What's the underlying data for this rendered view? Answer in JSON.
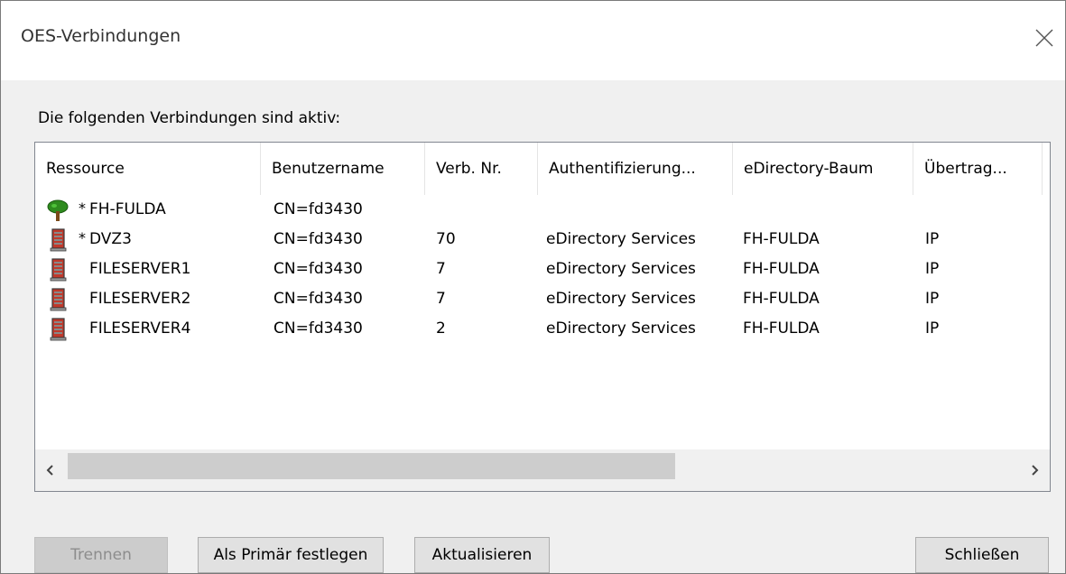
{
  "window": {
    "title": "OES-Verbindungen",
    "close_icon": "close-icon"
  },
  "intro_text": "Die folgenden Verbindungen sind aktiv:",
  "columns": [
    "Ressource",
    "Benutzername",
    "Verb. Nr.",
    "Authentifizierung...",
    "eDirectory-Baum",
    "Übertrag..."
  ],
  "rows": [
    {
      "icon": "tree-icon",
      "primary": "*",
      "resource": "FH-FULDA",
      "user": "CN=fd3430",
      "conn_nr": "",
      "auth": "",
      "tree": "",
      "transport": ""
    },
    {
      "icon": "server-icon",
      "primary": "*",
      "resource": "DVZ3",
      "user": "CN=fd3430",
      "conn_nr": "70",
      "auth": "eDirectory Services",
      "tree": "FH-FULDA",
      "transport": "IP"
    },
    {
      "icon": "server-icon",
      "primary": "",
      "resource": "FILESERVER1",
      "user": "CN=fd3430",
      "conn_nr": "7",
      "auth": "eDirectory Services",
      "tree": "FH-FULDA",
      "transport": "IP"
    },
    {
      "icon": "server-icon",
      "primary": "",
      "resource": "FILESERVER2",
      "user": "CN=fd3430",
      "conn_nr": "7",
      "auth": "eDirectory Services",
      "tree": "FH-FULDA",
      "transport": "IP"
    },
    {
      "icon": "server-icon",
      "primary": "",
      "resource": "FILESERVER4",
      "user": "CN=fd3430",
      "conn_nr": "2",
      "auth": "eDirectory Services",
      "tree": "FH-FULDA",
      "transport": "IP"
    }
  ],
  "scroll": {
    "left_icon": "chevron-left-icon",
    "right_icon": "chevron-right-icon"
  },
  "buttons": {
    "disconnect": "Trennen",
    "set_primary": "Als Primär festlegen",
    "refresh": "Aktualisieren",
    "close": "Schließen"
  },
  "colors": {
    "background": "#f0f0f0",
    "disabled_text": "#8d8d8d",
    "server_red": "#c0392b",
    "tree_green": "#2e8b1e"
  }
}
